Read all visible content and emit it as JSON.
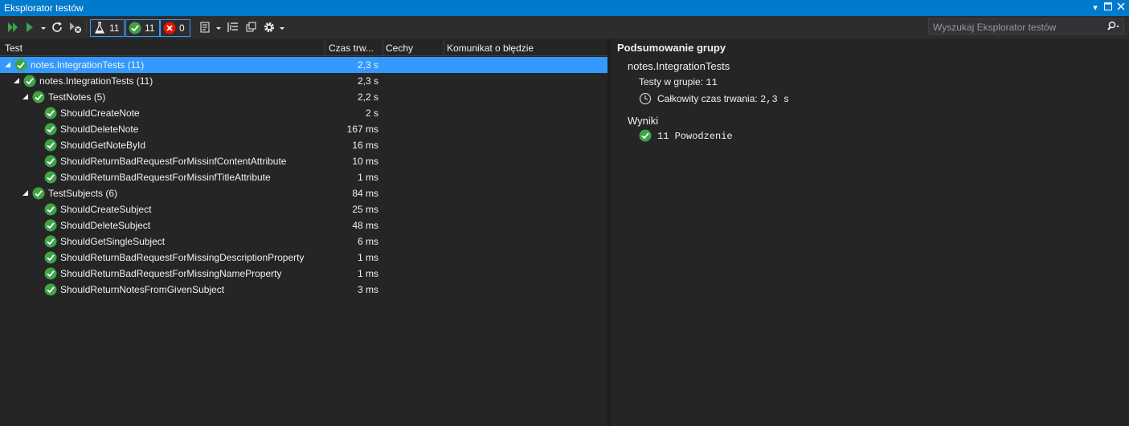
{
  "window": {
    "title": "Eksplorator testów"
  },
  "toolbar": {
    "total_count": "11",
    "passed_count": "11",
    "failed_count": "0"
  },
  "search": {
    "placeholder": "Wyszukaj Eksplorator testów"
  },
  "columns": {
    "test": "Test",
    "duration": "Czas trw...",
    "traits": "Cechy",
    "error": "Komunikat o błędzie"
  },
  "tree": [
    {
      "name": "notes.IntegrationTests  (11)",
      "duration": "2,3 s",
      "status": "passed"
    },
    {
      "name": "notes.IntegrationTests  (11)",
      "duration": "2,3 s",
      "status": "passed"
    },
    {
      "name": "TestNotes  (5)",
      "duration": "2,2 s",
      "status": "passed"
    },
    {
      "name": "ShouldCreateNote",
      "duration": "2 s",
      "status": "passed"
    },
    {
      "name": "ShouldDeleteNote",
      "duration": "167 ms",
      "status": "passed"
    },
    {
      "name": "ShouldGetNoteById",
      "duration": "16 ms",
      "status": "passed"
    },
    {
      "name": "ShouldReturnBadRequestForMissinfContentAttribute",
      "duration": "10 ms",
      "status": "passed"
    },
    {
      "name": "ShouldReturnBadRequestForMissinfTitleAttribute",
      "duration": "1 ms",
      "status": "passed"
    },
    {
      "name": "TestSubjects  (6)",
      "duration": "84 ms",
      "status": "passed"
    },
    {
      "name": "ShouldCreateSubject",
      "duration": "25 ms",
      "status": "passed"
    },
    {
      "name": "ShouldDeleteSubject",
      "duration": "48 ms",
      "status": "passed"
    },
    {
      "name": "ShouldGetSingleSubject",
      "duration": "6 ms",
      "status": "passed"
    },
    {
      "name": "ShouldReturnBadRequestForMissingDescriptionProperty",
      "duration": "1 ms",
      "status": "passed"
    },
    {
      "name": "ShouldReturnBadRequestForMissingNameProperty",
      "duration": "1 ms",
      "status": "passed"
    },
    {
      "name": "ShouldReturnNotesFromGivenSubject",
      "duration": "3 ms",
      "status": "passed"
    }
  ],
  "summary": {
    "heading": "Podsumowanie grupy",
    "group_name": "notes.IntegrationTests",
    "tests_label": "Testy w grupie:",
    "tests_value": "11",
    "duration_label": "Całkowity czas trwania:",
    "duration_value": "2,3 s",
    "results_label": "Wyniki",
    "passed_count": "11",
    "passed_label": "Powodzenie"
  },
  "colors": {
    "accent": "#007acc",
    "selection": "#3399ff",
    "pass": "#3ea345",
    "fail": "#e51400",
    "background": "#252526"
  }
}
